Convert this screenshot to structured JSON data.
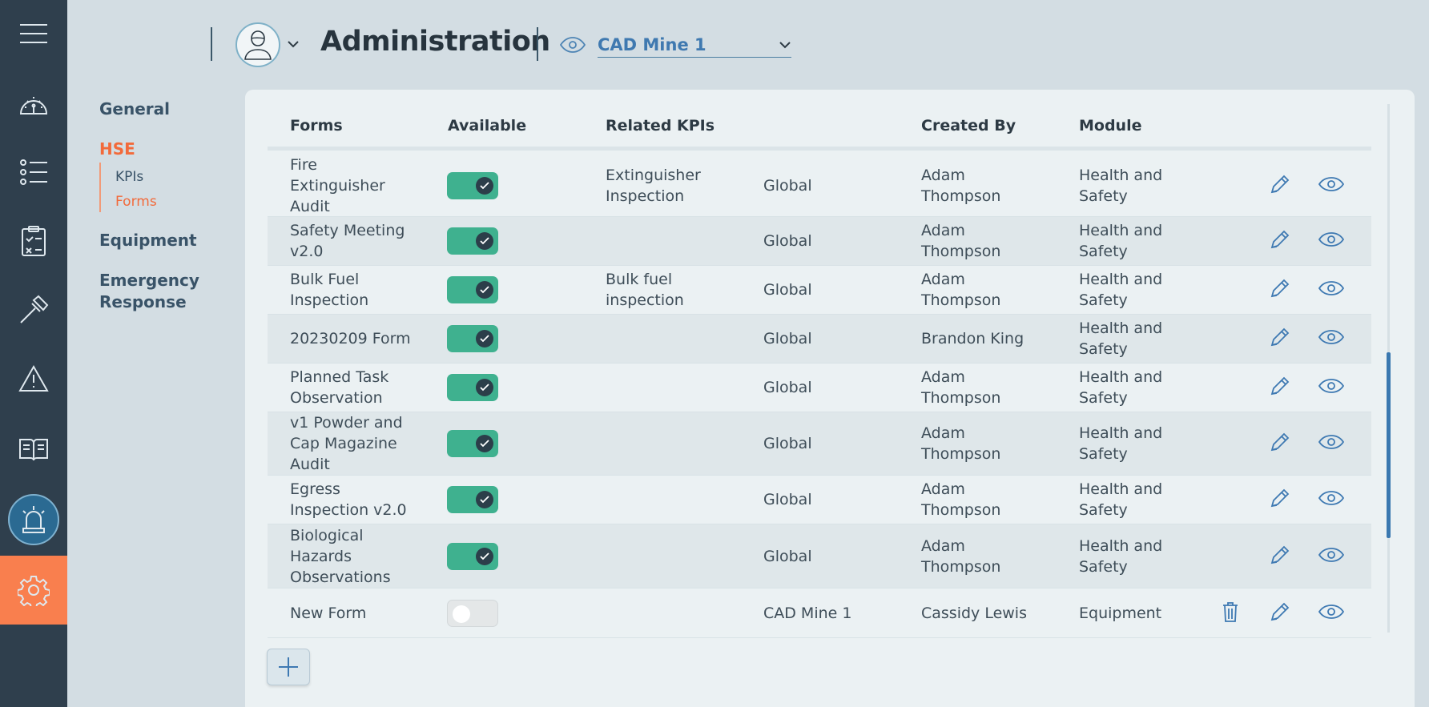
{
  "header": {
    "title": "Administration",
    "site": "CAD Mine 1"
  },
  "subnav": {
    "general": "General",
    "hse": "HSE",
    "kpis": "KPIs",
    "forms": "Forms",
    "equipment": "Equipment",
    "emergency_line1": "Emergency",
    "emergency_line2": "Response"
  },
  "table": {
    "headers": {
      "forms": "Forms",
      "available": "Available",
      "related_kpis": "Related KPIs",
      "created_by": "Created By",
      "module": "Module"
    },
    "rows": [
      {
        "form": [
          "Fire",
          "Extinguisher",
          "Audit"
        ],
        "available": true,
        "kpi": [
          "Extinguisher",
          "Inspection"
        ],
        "scope": "Global",
        "created": [
          "Adam",
          "Thompson"
        ],
        "module": [
          "Health and",
          "Safety"
        ],
        "delete": false
      },
      {
        "form": [
          "Safety Meeting",
          "v2.0"
        ],
        "available": true,
        "kpi": [],
        "scope": "Global",
        "created": [
          "Adam",
          "Thompson"
        ],
        "module": [
          "Health and",
          "Safety"
        ],
        "delete": false
      },
      {
        "form": [
          "Bulk Fuel",
          "Inspection"
        ],
        "available": true,
        "kpi": [
          "Bulk fuel",
          "inspection"
        ],
        "scope": "Global",
        "created": [
          "Adam",
          "Thompson"
        ],
        "module": [
          "Health and",
          "Safety"
        ],
        "delete": false
      },
      {
        "form": [
          "20230209 Form"
        ],
        "available": true,
        "kpi": [],
        "scope": "Global",
        "created": [
          "Brandon King"
        ],
        "module": [
          "Health and",
          "Safety"
        ],
        "delete": false
      },
      {
        "form": [
          "Planned Task",
          "Observation"
        ],
        "available": true,
        "kpi": [],
        "scope": "Global",
        "created": [
          "Adam",
          "Thompson"
        ],
        "module": [
          "Health and",
          "Safety"
        ],
        "delete": false
      },
      {
        "form": [
          "v1 Powder and",
          "Cap Magazine",
          "Audit"
        ],
        "available": true,
        "kpi": [],
        "scope": "Global",
        "created": [
          "Adam",
          "Thompson"
        ],
        "module": [
          "Health and",
          "Safety"
        ],
        "delete": false
      },
      {
        "form": [
          "Egress",
          "Inspection v2.0"
        ],
        "available": true,
        "kpi": [],
        "scope": "Global",
        "created": [
          "Adam",
          "Thompson"
        ],
        "module": [
          "Health and",
          "Safety"
        ],
        "delete": false
      },
      {
        "form": [
          "Biological",
          "Hazards",
          "Observations"
        ],
        "available": true,
        "kpi": [],
        "scope": "Global",
        "created": [
          "Adam",
          "Thompson"
        ],
        "module": [
          "Health and",
          "Safety"
        ],
        "delete": false
      },
      {
        "form": [
          "New Form"
        ],
        "available": false,
        "kpi": [],
        "scope": "CAD Mine 1",
        "created": [
          "Cassidy Lewis"
        ],
        "module": [
          "Equipment"
        ],
        "delete": true
      }
    ]
  },
  "icons": {
    "menu": "menu-icon",
    "dashboard": "gauge-icon",
    "list": "list-icon",
    "checklist": "clipboard-icon",
    "tools": "hammer-icon",
    "warning": "warning-icon",
    "book": "book-icon",
    "alarm": "alarm-icon",
    "settings": "gear-icon"
  },
  "colors": {
    "rail": "#2f3f4d",
    "accent": "#f97f4e",
    "toggle_on": "#3fb18f",
    "link": "#3f79b0"
  }
}
